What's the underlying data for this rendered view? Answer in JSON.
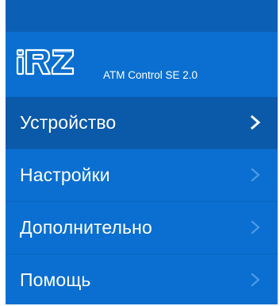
{
  "app": {
    "logo_text": "iRZ",
    "title": "ATM Control SE 2.0"
  },
  "menu": {
    "items": [
      {
        "label": "Устройство",
        "active": true
      },
      {
        "label": "Настройки",
        "active": false
      },
      {
        "label": "Дополнительно",
        "active": false
      },
      {
        "label": "Помощь",
        "active": false
      }
    ]
  },
  "colors": {
    "panel": "#0a6fd0",
    "topbar": "#0b5fb5",
    "active_item": "#0b59a9",
    "chevron_active": "#ffffff",
    "chevron_inactive": "#4d9be6"
  },
  "icons": {
    "logo": "irz-logo",
    "chevron": "chevron-right-icon"
  }
}
